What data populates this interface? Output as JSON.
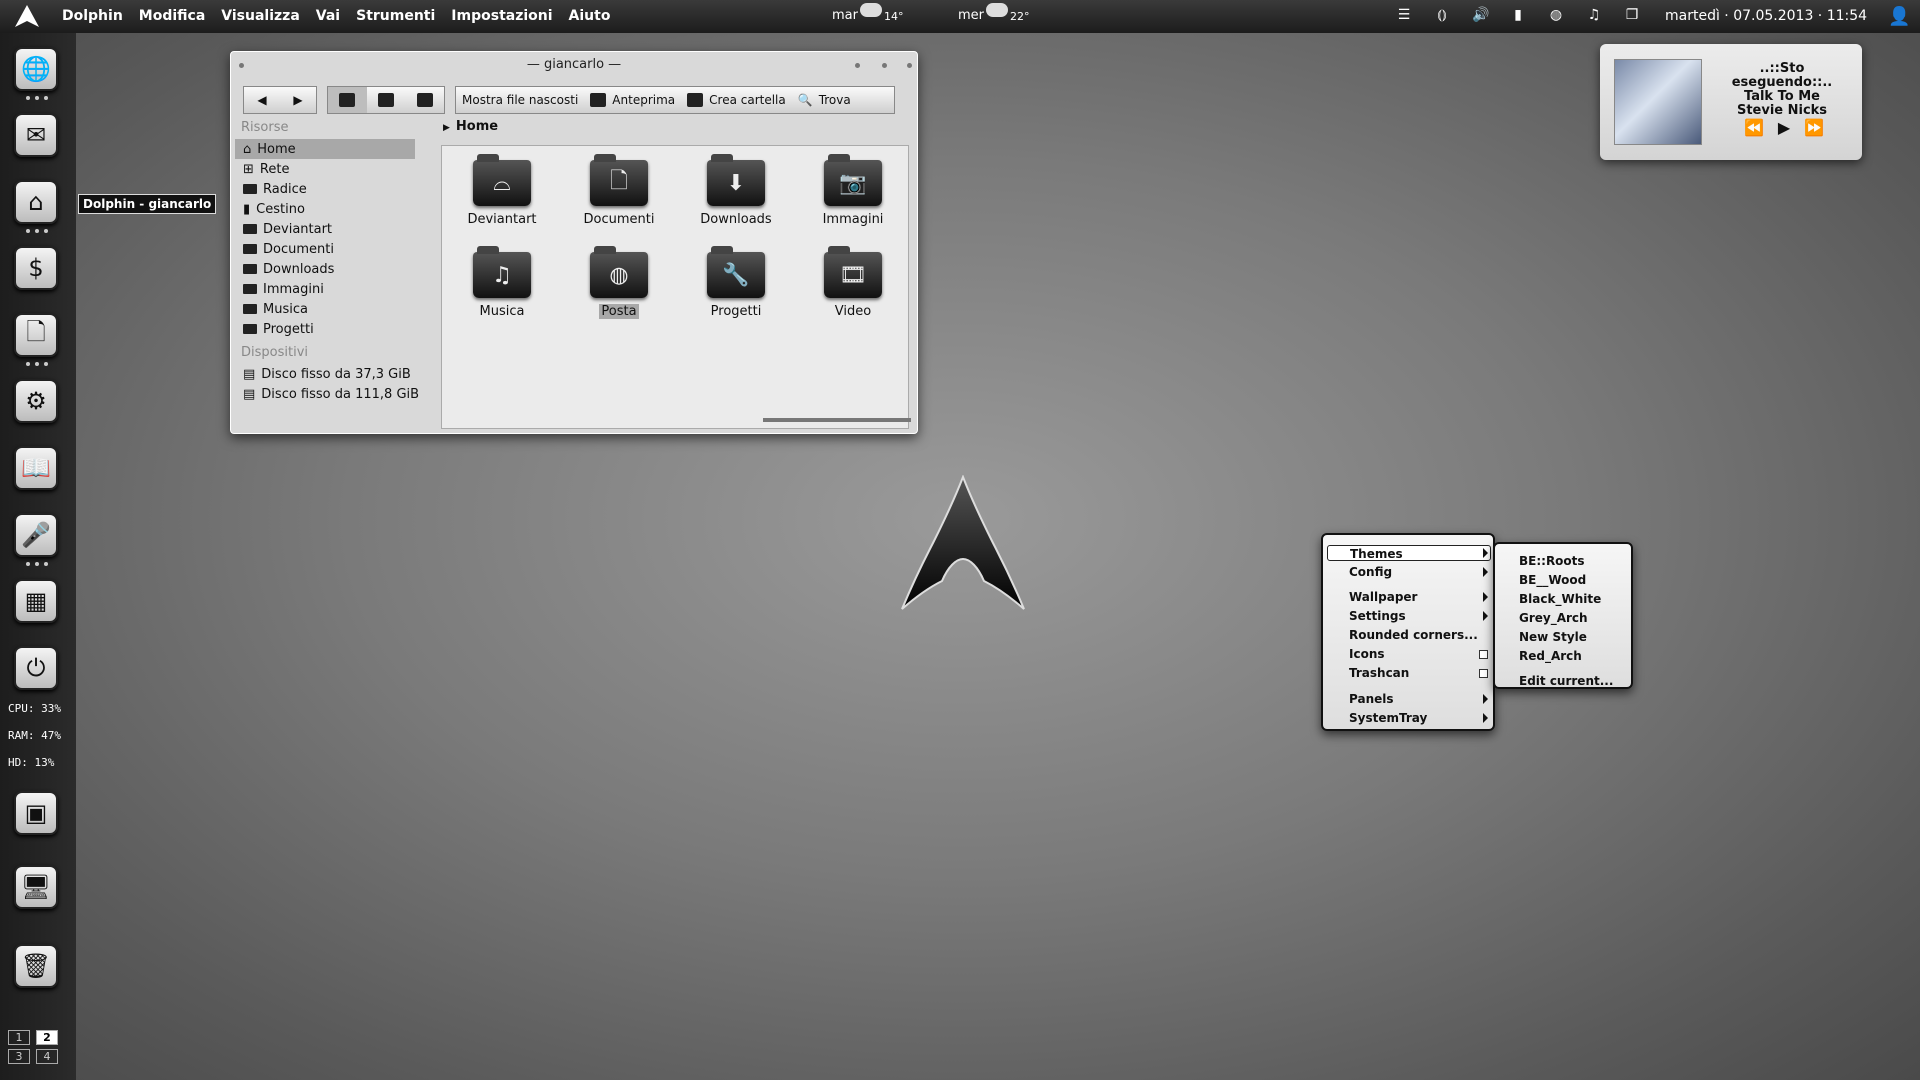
{
  "topbar": {
    "menu": [
      "Dolphin",
      "Modifica",
      "Visualizza",
      "Vai",
      "Strumenti",
      "Impostazioni",
      "Aiuto"
    ],
    "weather": [
      {
        "day": "mar",
        "temp": "14°"
      },
      {
        "day": "mer",
        "temp": "22°"
      }
    ],
    "clock": "martedì  ·  07.05.2013  ·  11:54"
  },
  "dock": {
    "stats": {
      "cpu": "CPU: 33%",
      "ram": "RAM: 47%",
      "hd": "HD: 13%"
    },
    "pager": [
      "1",
      "2",
      "3",
      "4"
    ],
    "tooltip": "Dolphin - giancarlo"
  },
  "dolphin": {
    "title": "giancarlo",
    "toolbar": {
      "hidden": "Mostra file nascosti",
      "preview": "Anteprima",
      "newfolder": "Crea cartella",
      "find": "Trova"
    },
    "places_header": "Risorse",
    "places": [
      "Home",
      "Rete",
      "Radice",
      "Cestino",
      "Deviantart",
      "Documenti",
      "Downloads",
      "Immagini",
      "Musica",
      "Progetti"
    ],
    "devices_header": "Dispositivi",
    "devices": [
      "Disco fisso da 37,3 GiB",
      "Disco fisso da 111,8 GiB"
    ],
    "breadcrumb": "Home",
    "files": [
      "Deviantart",
      "Documenti",
      "Downloads",
      "Immagini",
      "Musica",
      "Posta",
      "Progetti",
      "Video"
    ]
  },
  "music": {
    "status": "..::Sto eseguendo::..",
    "track": "Talk To Me",
    "artist": "Stevie Nicks"
  },
  "context_menu": {
    "items": [
      "Themes",
      "Config",
      "Wallpaper",
      "Settings",
      "Rounded corners...",
      "Icons",
      "Trashcan",
      "Panels",
      "SystemTray"
    ],
    "themes": [
      "BE::Roots",
      "BE__Wood",
      "Black_White",
      "Grey_Arch",
      "New Style",
      "Red_Arch",
      "Edit current..."
    ]
  }
}
